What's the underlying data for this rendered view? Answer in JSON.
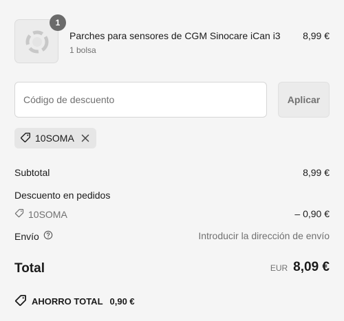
{
  "line_item": {
    "quantity_badge": "1",
    "title": "Parches para sensores de CGM Sinocare iCan i3",
    "variant": "1 bolsa",
    "price": "8,99 €"
  },
  "discount": {
    "placeholder": "Código de descuento",
    "value": "",
    "apply_label": "Aplicar"
  },
  "applied_code": {
    "code": "10SOMA"
  },
  "summary": {
    "subtotal_label": "Subtotal",
    "subtotal_value": "8,99 €",
    "order_discount_label": "Descuento en pedidos",
    "order_discount_code": "10SOMA",
    "order_discount_value": "– 0,90 €",
    "shipping_label": "Envío",
    "shipping_value": "Introducir la dirección de envío"
  },
  "total": {
    "label": "Total",
    "currency": "EUR",
    "amount": "8,09 €"
  },
  "savings": {
    "label": "AHORRO TOTAL",
    "amount": "0,90 €"
  },
  "icons": {
    "tag": "tag-icon",
    "close": "close-icon",
    "help": "help-circle-icon",
    "savings_tag": "savings-tag-icon"
  }
}
